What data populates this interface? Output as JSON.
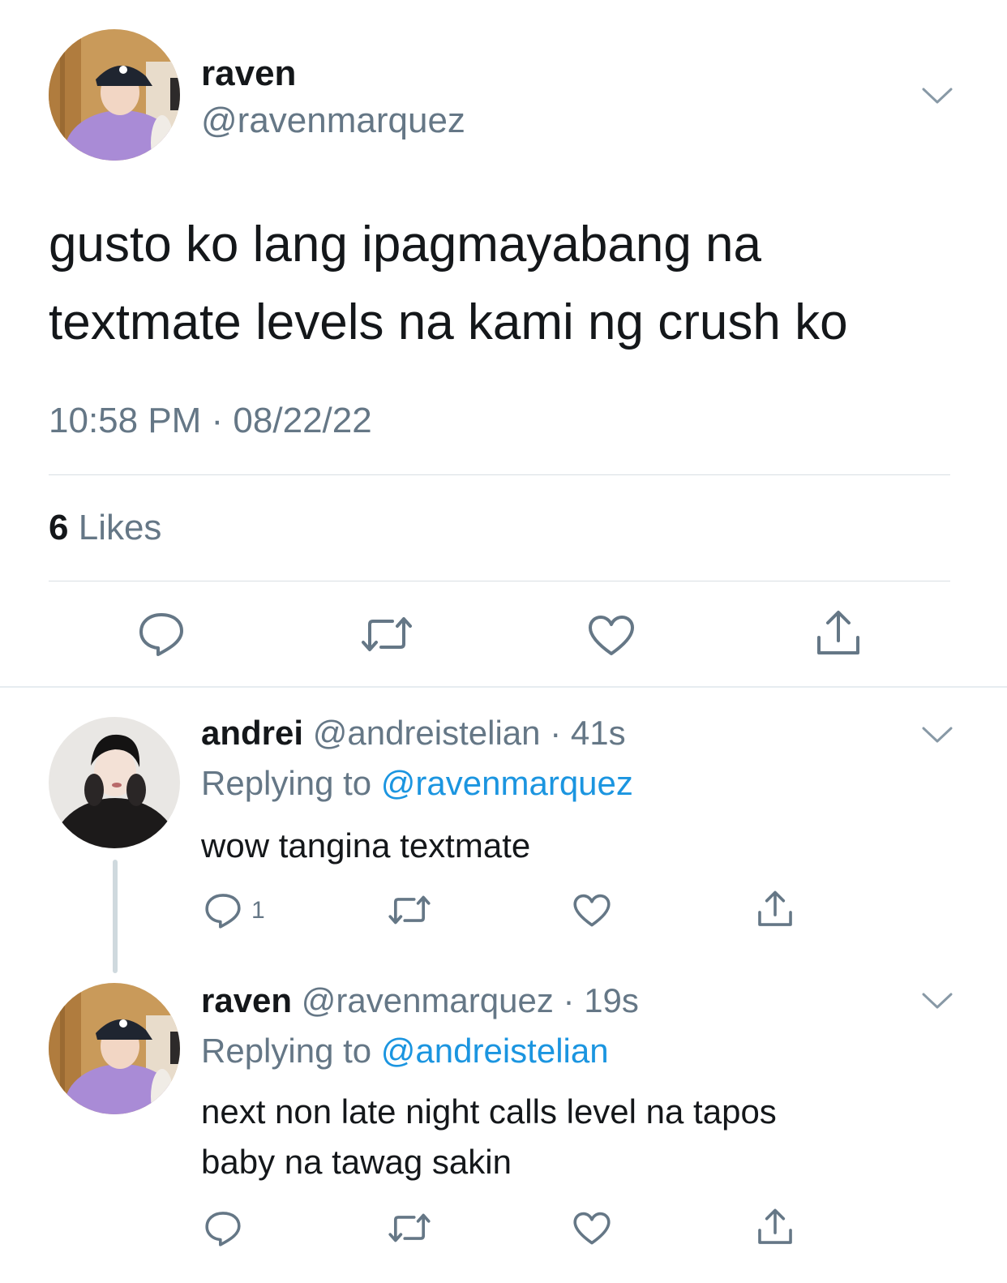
{
  "colors": {
    "text": "#14171a",
    "secondary": "#657786",
    "link": "#1b95e0",
    "divider": "#d9dfe4"
  },
  "main_tweet": {
    "name": "raven",
    "handle": "@ravenmarquez",
    "text_line1": "gusto ko lang ipagmayabang na",
    "text_line2": "textmate levels na kami ng crush ko",
    "timestamp": "10:58 PM · 08/22/22",
    "likes_count": "6",
    "likes_label": "Likes",
    "icons": [
      "reply-icon",
      "retweet-icon",
      "like-icon",
      "share-icon",
      "chevron-down-icon"
    ]
  },
  "replies": [
    {
      "name": "andrei",
      "handle": "@andreistelian",
      "dot": "·",
      "time": "41s",
      "replying_label": "Replying to",
      "replying_mention": "@ravenmarquez",
      "text": "wow tangina textmate",
      "reply_count": "1"
    },
    {
      "name": "raven",
      "handle": "@ravenmarquez",
      "dot": "·",
      "time": "19s",
      "replying_label": "Replying to",
      "replying_mention": "@andreistelian",
      "text_line1": "next non late night calls level na tapos",
      "text_line2": "baby na tawag sakin"
    }
  ]
}
